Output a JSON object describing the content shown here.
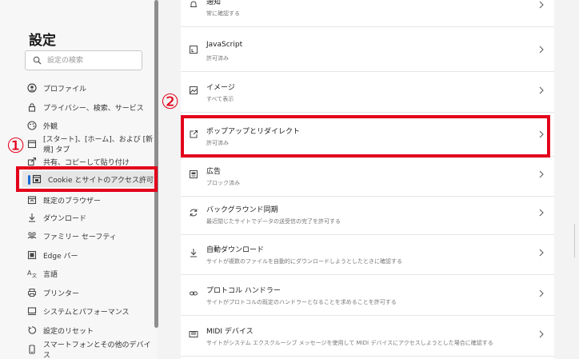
{
  "sidebar": {
    "title": "設定",
    "search_placeholder": "設定の検索",
    "items": [
      {
        "label": "プロファイル",
        "icon": "profile-icon"
      },
      {
        "label": "プライバシー、検索、サービス",
        "icon": "lock-icon"
      },
      {
        "label": "外観",
        "icon": "appearance-icon"
      },
      {
        "label": "[スタート]、[ホーム]、および [新規] タブ",
        "icon": "tabs-icon"
      },
      {
        "label": "共有、コピーして貼り付け",
        "icon": "share-icon"
      },
      {
        "label": "Cookie とサイトのアクセス許可",
        "icon": "cookie-site-icon"
      },
      {
        "label": "既定のブラウザー",
        "icon": "browser-icon"
      },
      {
        "label": "ダウンロード",
        "icon": "download-icon"
      },
      {
        "label": "ファミリー セーフティ",
        "icon": "family-icon"
      },
      {
        "label": "Edge バー",
        "icon": "edge-bar-icon"
      },
      {
        "label": "言語",
        "icon": "language-icon"
      },
      {
        "label": "プリンター",
        "icon": "printer-icon"
      },
      {
        "label": "システムとパフォーマンス",
        "icon": "system-icon"
      },
      {
        "label": "設定のリセット",
        "icon": "reset-icon"
      },
      {
        "label": "スマートフォンとその他のデバイス",
        "icon": "phone-icon"
      }
    ],
    "active_index": 5
  },
  "main": {
    "rows": [
      {
        "title": "通知",
        "subtitle": "常に確認する",
        "icon": "bell-icon"
      },
      {
        "title": "JavaScript",
        "subtitle": "許可済み",
        "icon": "javascript-icon"
      },
      {
        "title": "イメージ",
        "subtitle": "すべて表示",
        "icon": "image-icon"
      },
      {
        "title": "ポップアップとリダイレクト",
        "subtitle": "許可済み",
        "icon": "popup-icon"
      },
      {
        "title": "広告",
        "subtitle": "ブロック済み",
        "icon": "ads-icon"
      },
      {
        "title": "バックグラウンド同期",
        "subtitle": "最近閉じたサイトでデータの送受信の完了を許可する",
        "icon": "sync-icon"
      },
      {
        "title": "自動ダウンロード",
        "subtitle": "サイトが複数のファイルを自動的にダウンロードしようとしたときに確認する",
        "icon": "download-icon"
      },
      {
        "title": "プロトコル ハンドラー",
        "subtitle": "サイトがプロトコルの既定のハンドラーとなることを求めることを許可する",
        "icon": "protocol-icon"
      },
      {
        "title": "MIDI デバイス",
        "subtitle": "サイトがシステム エクスクルーシブ メッセージを使用して MIDI デバイスにアクセスしようとした場合に確認する",
        "icon": "midi-icon"
      }
    ]
  },
  "annotations": {
    "marker1": "①",
    "marker2": "②",
    "highlight_color": "#e3001b"
  }
}
